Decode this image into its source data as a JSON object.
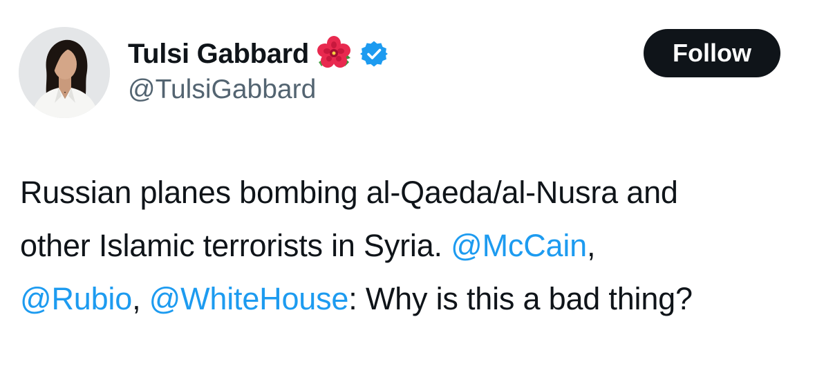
{
  "author": {
    "display_name": "Tulsi Gabbard",
    "handle": "@TulsiGabbard",
    "name_emoji": "hibiscus-icon",
    "verified_badge": "verified-icon",
    "verified_color": "#1d9bf0"
  },
  "follow_button": {
    "label": "Follow",
    "background": "#0f1419",
    "text_color": "#ffffff"
  },
  "tweet": {
    "line1": "Russian planes bombing al-Qaeda/al-Nusra and",
    "line2_text": "other Islamic terrorists in Syria. ",
    "mention1": "@McCain",
    "sep1": ",",
    "mention2": "@Rubio",
    "sep2": ", ",
    "mention3": "@WhiteHouse",
    "tail": ": Why is this a bad thing?",
    "mention_color": "#1d9bf0"
  }
}
